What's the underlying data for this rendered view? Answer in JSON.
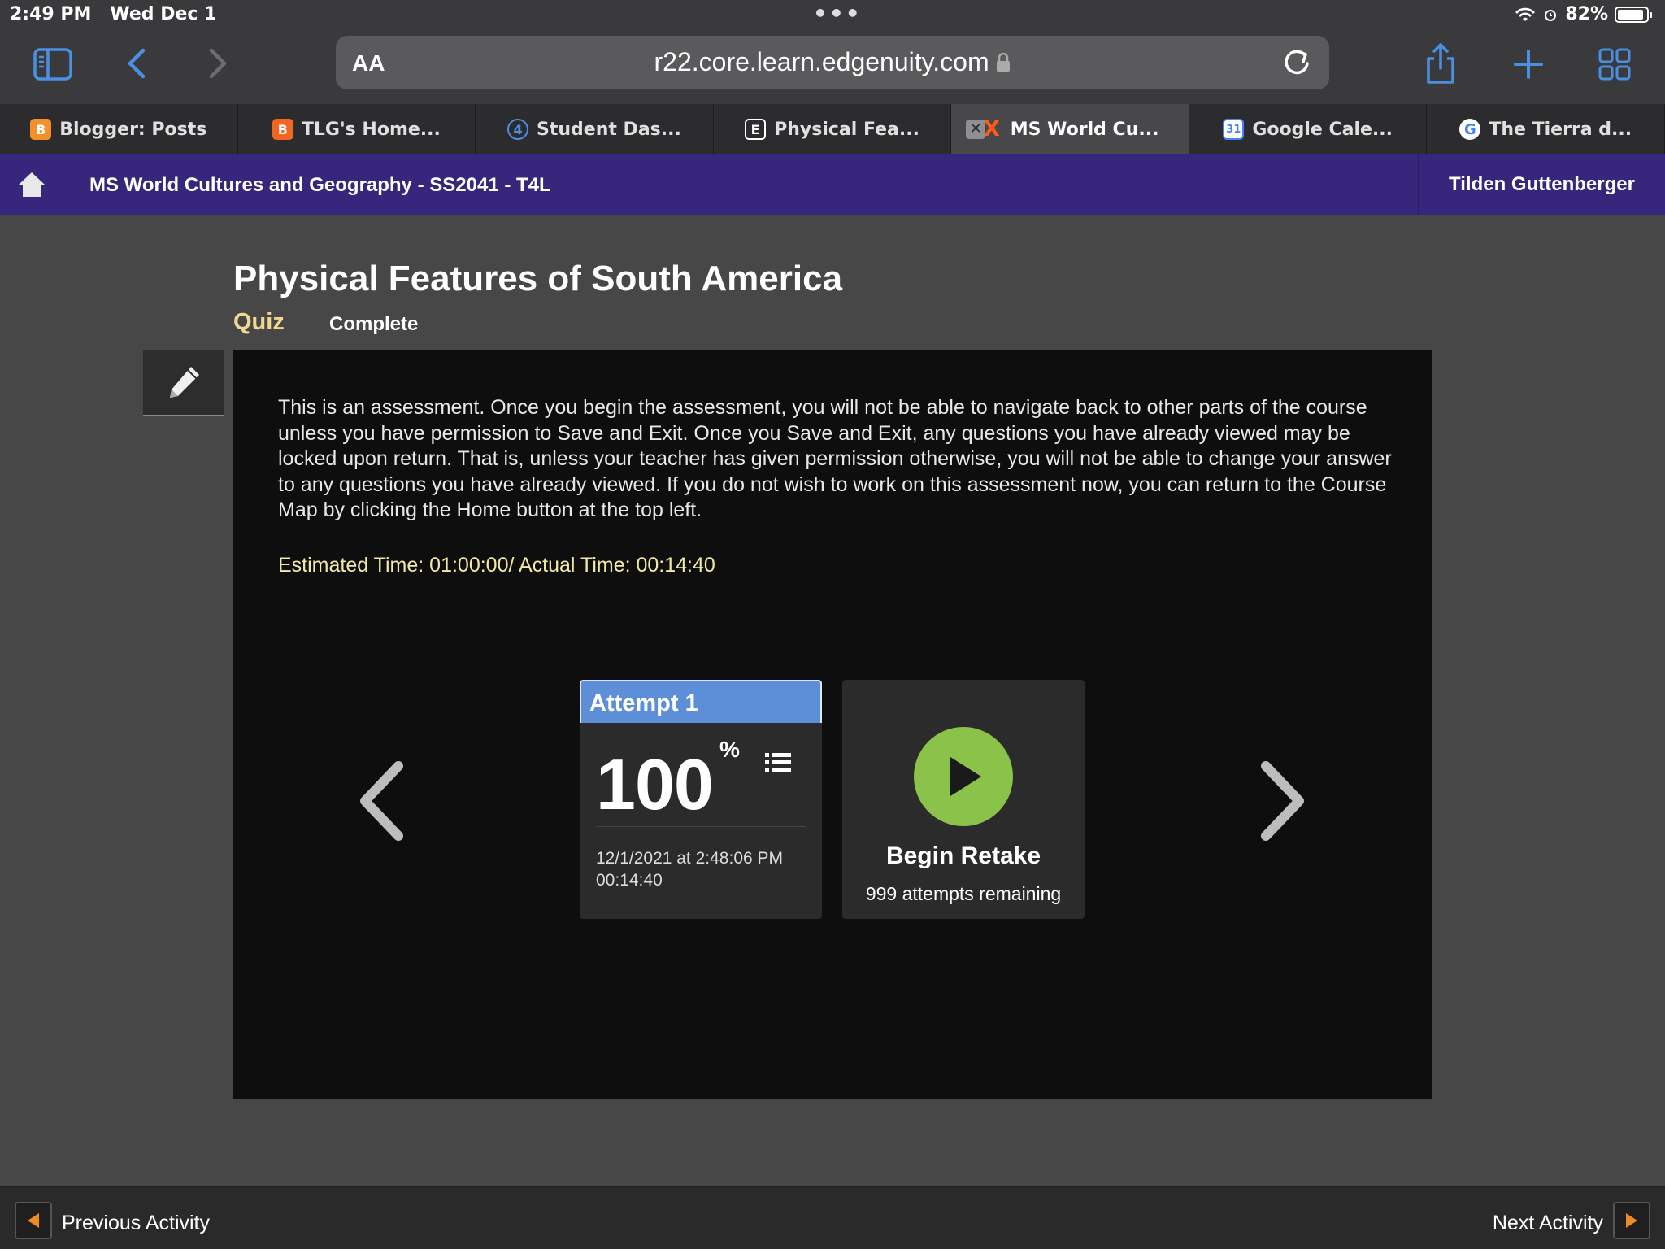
{
  "status_bar": {
    "time": "2:49 PM",
    "date": "Wed Dec 1",
    "battery": "82%"
  },
  "browser": {
    "url": "r22.core.learn.edgenuity.com",
    "aa_label": "AA",
    "tabs": [
      {
        "label": "Blogger: Posts",
        "favicon": "B",
        "color": "#f4902a"
      },
      {
        "label": "TLG's Home...",
        "favicon": "B",
        "color": "#f26522"
      },
      {
        "label": "Student Das...",
        "favicon": "4",
        "color": "#3a6fc4"
      },
      {
        "label": "Physical Fea...",
        "favicon": "E",
        "color": "#2c2c2e"
      },
      {
        "label": "MS World Cu...",
        "favicon": "X",
        "color": "#ff5a1f",
        "active": true
      },
      {
        "label": "Google Cale...",
        "favicon": "31",
        "color": "#4285f4"
      },
      {
        "label": "The Tierra d...",
        "favicon": "G",
        "color": "#ffffff"
      }
    ]
  },
  "course": {
    "title": "MS World Cultures and Geography - SS2041 - T4L",
    "user": "Tilden Guttenberger"
  },
  "activity": {
    "title": "Physical Features of South America",
    "type": "Quiz",
    "status": "Complete",
    "instructions": "This is an assessment. Once you begin the assessment, you will not be able to navigate back to other parts of the course unless you have permission to Save and Exit. Once you Save and Exit, any questions you have already viewed may be locked upon return. That is, unless your teacher has given permission otherwise, you will not be able to change your answer to any questions you have already viewed. If you do not wish to work on this assessment now, you can return to the Course Map by clicking the Home button at the top left.",
    "timer": "Estimated Time: 01:00:00/ Actual Time: 00:14:40"
  },
  "attempt": {
    "title": "Attempt 1",
    "score": "100",
    "score_unit": "%",
    "date": "12/1/2021 at 2:48:06 PM",
    "duration": "00:14:40"
  },
  "retake": {
    "label": "Begin Retake",
    "remaining": "999 attempts remaining"
  },
  "footer": {
    "previous": "Previous Activity",
    "next": "Next Activity"
  },
  "colors": {
    "course_bar": "#37277c",
    "attempt_header": "#5d8fd9",
    "play_button": "#8bc34a",
    "quiz_label": "#f0d890",
    "nav_accent": "#f08a24"
  }
}
